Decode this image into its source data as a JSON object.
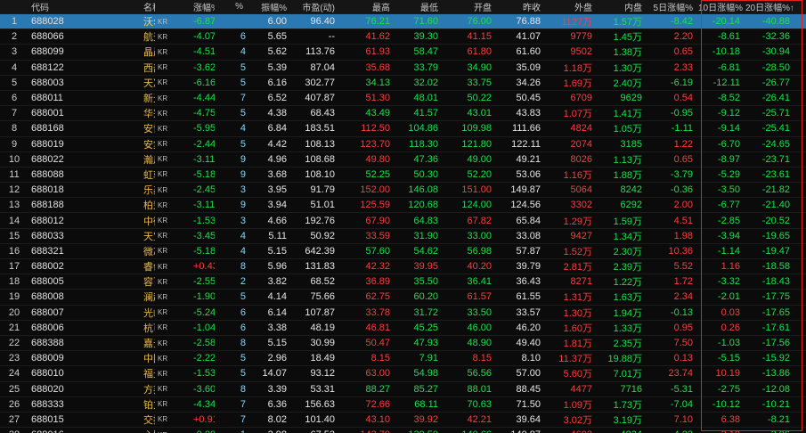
{
  "header": {
    "code": "代码",
    "name": "名称",
    "pct": "涨幅%",
    "pct_small": "%",
    "amp": "振幅%",
    "pe": "市盈(动)",
    "high": "最高",
    "low": "最低",
    "open": "开盘",
    "prev": "昨收",
    "outer": "外盘",
    "inner": "内盘",
    "d5": "5日涨幅%",
    "d10": "10日涨幅%",
    "d20": "20日涨幅%↑"
  },
  "colors": {
    "up": "#ff3c3c",
    "down": "#19e34a",
    "selected": "#2a79b3",
    "highlight_box": "#e0241b"
  },
  "rows": [
    {
      "idx": "1",
      "code": "688028",
      "name": "沃尔德",
      "tag": "KR",
      "pct": "-6.87%",
      "frag": "",
      "amp": "6.00",
      "pe": "96.40",
      "high": "76.21",
      "low": "71.60",
      "open": "76.00",
      "prev": "76.88",
      "outer": "1127万",
      "inner": "1.57万",
      "d5": "-8.42",
      "d10": "-20.14",
      "d20": "-40.88"
    },
    {
      "idx": "2",
      "code": "688066",
      "name": "航天宏图",
      "tag": "KR",
      "pct": "-4.07%",
      "frag": "6",
      "amp": "5.65",
      "pe": "--",
      "high": "41.62",
      "low": "39.30",
      "open": "41.15",
      "prev": "41.07",
      "outer": "9779",
      "inner": "1.45万",
      "d5": "2.20",
      "d10": "-8.61",
      "d20": "-32.36"
    },
    {
      "idx": "3",
      "code": "688099",
      "name": "晶晨股份",
      "tag": "KR",
      "pct": "-4.51%",
      "frag": "4",
      "amp": "5.62",
      "pe": "113.76",
      "high": "61.93",
      "low": "58.47",
      "open": "61.80",
      "prev": "61.60",
      "outer": "9502",
      "inner": "1.38万",
      "d5": "0.65",
      "d10": "-10.18",
      "d20": "-30.94"
    },
    {
      "idx": "4",
      "code": "688122",
      "name": "西部超导",
      "tag": "KR",
      "pct": "-3.62%",
      "frag": "5",
      "amp": "5.39",
      "pe": "87.04",
      "high": "35.68",
      "low": "33.79",
      "open": "34.90",
      "prev": "35.09",
      "outer": "1.18万",
      "inner": "1.30万",
      "d5": "2.33",
      "d10": "-6.81",
      "d20": "-28.50"
    },
    {
      "idx": "5",
      "code": "688003",
      "name": "天准科技",
      "tag": "KR",
      "pct": "-6.16%",
      "frag": "5",
      "amp": "6.16",
      "pe": "302.77",
      "high": "34.13",
      "low": "32.02",
      "open": "33.75",
      "prev": "34.26",
      "outer": "1.69万",
      "inner": "2.40万",
      "d5": "-6.19",
      "d10": "-12.11",
      "d20": "-26.77"
    },
    {
      "idx": "6",
      "code": "688011",
      "name": "新光光电",
      "tag": "KR",
      "pct": "-4.44%",
      "frag": "7",
      "amp": "6.52",
      "pe": "407.87",
      "high": "51.30",
      "low": "48.01",
      "open": "50.22",
      "prev": "50.45",
      "outer": "6709",
      "inner": "9629",
      "d5": "0.54",
      "d10": "-8.52",
      "d20": "-26.41"
    },
    {
      "idx": "7",
      "code": "688001",
      "name": "华兴源创",
      "tag": "KR",
      "pct": "-4.75%",
      "frag": "5",
      "amp": "4.38",
      "pe": "68.43",
      "high": "43.49",
      "low": "41.57",
      "open": "43.01",
      "prev": "43.83",
      "outer": "1.07万",
      "inner": "1.41万",
      "d5": "-0.95",
      "d10": "-9.12",
      "d20": "-25.71"
    },
    {
      "idx": "8",
      "code": "688168",
      "name": "安博通",
      "tag": "KR",
      "pct": "-5.95%",
      "frag": "4",
      "amp": "6.84",
      "pe": "183.51",
      "high": "112.50",
      "low": "104.86",
      "open": "109.98",
      "prev": "111.66",
      "outer": "4824",
      "inner": "1.05万",
      "d5": "-1.11",
      "d10": "-9.14",
      "d20": "-25.41"
    },
    {
      "idx": "9",
      "code": "688019",
      "name": "安集科技",
      "tag": "KR",
      "pct": "-2.44%",
      "frag": "5",
      "amp": "4.42",
      "pe": "108.13",
      "high": "123.70",
      "low": "118.30",
      "open": "121.80",
      "prev": "122.11",
      "outer": "2074",
      "inner": "3185",
      "d5": "1.22",
      "d10": "-6.70",
      "d20": "-24.65"
    },
    {
      "idx": "10",
      "code": "688022",
      "name": "瀚川智能",
      "tag": "KR",
      "pct": "-3.11%",
      "frag": "9",
      "amp": "4.96",
      "pe": "108.68",
      "high": "49.80",
      "low": "47.36",
      "open": "49.00",
      "prev": "49.21",
      "outer": "8026",
      "inner": "1.13万",
      "d5": "0.65",
      "d10": "-8.97",
      "d20": "-23.71"
    },
    {
      "idx": "11",
      "code": "688088",
      "name": "虹软科技",
      "tag": "KR",
      "pct": "-5.18%",
      "frag": "9",
      "amp": "3.68",
      "pe": "108.10",
      "high": "52.25",
      "low": "50.30",
      "open": "52.20",
      "prev": "53.06",
      "outer": "1.16万",
      "inner": "1.88万",
      "d5": "-3.79",
      "d10": "-5.29",
      "d20": "-23.61"
    },
    {
      "idx": "12",
      "code": "688018",
      "name": "乐鑫科技",
      "tag": "KR",
      "pct": "-2.45%",
      "frag": "3",
      "amp": "3.95",
      "pe": "91.79",
      "high": "152.00",
      "low": "146.08",
      "open": "151.00",
      "prev": "149.87",
      "outer": "5064",
      "inner": "8242",
      "d5": "-0.36",
      "d10": "-3.50",
      "d20": "-21.82"
    },
    {
      "idx": "13",
      "code": "688188",
      "name": "柏楚电子",
      "tag": "KR",
      "pct": "-3.11%",
      "frag": "9",
      "amp": "3.94",
      "pe": "51.01",
      "high": "125.59",
      "low": "120.68",
      "open": "124.00",
      "prev": "124.56",
      "outer": "3302",
      "inner": "6292",
      "d5": "2.00",
      "d10": "-6.77",
      "d20": "-21.40"
    },
    {
      "idx": "14",
      "code": "688012",
      "name": "中微公司",
      "tag": "KR",
      "pct": "-1.53%",
      "frag": "3",
      "amp": "4.66",
      "pe": "192.76",
      "high": "67.90",
      "low": "64.83",
      "open": "67.82",
      "prev": "65.84",
      "outer": "1.29万",
      "inner": "1.59万",
      "d5": "4.51",
      "d10": "-2.85",
      "d20": "-20.52"
    },
    {
      "idx": "15",
      "code": "688033",
      "name": "天宜上佳",
      "tag": "KR",
      "pct": "-3.45%",
      "frag": "4",
      "amp": "5.11",
      "pe": "50.92",
      "high": "33.59",
      "low": "31.90",
      "open": "33.00",
      "prev": "33.08",
      "outer": "9427",
      "inner": "1.34万",
      "d5": "1.98",
      "d10": "-3.94",
      "d20": "-19.65"
    },
    {
      "idx": "16",
      "code": "688321",
      "name": "微芯生物",
      "tag": "KR",
      "pct": "-5.18%",
      "frag": "4",
      "amp": "5.15",
      "pe": "642.39",
      "high": "57.60",
      "low": "54.62",
      "open": "56.98",
      "prev": "57.87",
      "outer": "1.52万",
      "inner": "2.30万",
      "d5": "10.36",
      "d10": "-1.14",
      "d20": "-19.47"
    },
    {
      "idx": "17",
      "code": "688002",
      "name": "睿创微纳",
      "tag": "KR",
      "pct": "+0.43%",
      "frag": "8",
      "amp": "5.96",
      "pe": "131.83",
      "high": "42.32",
      "low": "39.95",
      "open": "40.20",
      "prev": "39.79",
      "outer": "2.81万",
      "inner": "2.39万",
      "d5": "5.52",
      "d10": "1.16",
      "d20": "-18.58"
    },
    {
      "idx": "18",
      "code": "688005",
      "name": "容百科技",
      "tag": "KR",
      "pct": "-2.55%",
      "frag": "2",
      "amp": "3.82",
      "pe": "68.52",
      "high": "36.89",
      "low": "35.50",
      "open": "36.41",
      "prev": "36.43",
      "outer": "8271",
      "inner": "1.22万",
      "d5": "1.72",
      "d10": "-3.32",
      "d20": "-18.43"
    },
    {
      "idx": "19",
      "code": "688008",
      "name": "澜起科技",
      "tag": "KR",
      "pct": "-1.90%",
      "frag": "5",
      "amp": "4.14",
      "pe": "75.66",
      "high": "62.75",
      "low": "60.20",
      "open": "61.57",
      "prev": "61.55",
      "outer": "1.31万",
      "inner": "1.63万",
      "d5": "2.34",
      "d10": "-2.01",
      "d20": "-17.75"
    },
    {
      "idx": "20",
      "code": "688007",
      "name": "光峰科技",
      "tag": "KR",
      "pct": "-5.24%",
      "frag": "6",
      "amp": "6.14",
      "pe": "107.87",
      "high": "33.78",
      "low": "31.72",
      "open": "33.50",
      "prev": "33.57",
      "outer": "1.30万",
      "inner": "1.94万",
      "d5": "-0.13",
      "d10": "0.03",
      "d20": "-17.65"
    },
    {
      "idx": "21",
      "code": "688006",
      "name": "杭可科技",
      "tag": "KR",
      "pct": "-1.04%",
      "frag": "6",
      "amp": "3.38",
      "pe": "48.19",
      "high": "46.81",
      "low": "45.25",
      "open": "46.00",
      "prev": "46.20",
      "outer": "1.60万",
      "inner": "1.33万",
      "d5": "0.95",
      "d10": "0.26",
      "d20": "-17.61"
    },
    {
      "idx": "22",
      "code": "688388",
      "name": "嘉元科技",
      "tag": "KR",
      "pct": "-2.58%",
      "frag": "8",
      "amp": "5.15",
      "pe": "30.99",
      "high": "50.47",
      "low": "47.93",
      "open": "48.90",
      "prev": "49.40",
      "outer": "1.81万",
      "inner": "2.35万",
      "d5": "7.50",
      "d10": "-1.03",
      "d20": "-17.56"
    },
    {
      "idx": "23",
      "code": "688009",
      "name": "中国通号",
      "tag": "KR",
      "pct": "-2.22%",
      "frag": "5",
      "amp": "2.96",
      "pe": "18.49",
      "high": "8.15",
      "low": "7.91",
      "open": "8.15",
      "prev": "8.10",
      "outer": "11.37万",
      "inner": "19.88万",
      "d5": "0.13",
      "d10": "-5.15",
      "d20": "-15.92"
    },
    {
      "idx": "24",
      "code": "688010",
      "name": "福光股份",
      "tag": "KR",
      "pct": "-1.53%",
      "frag": "5",
      "amp": "14.07",
      "pe": "93.12",
      "high": "63.00",
      "low": "54.98",
      "open": "56.56",
      "prev": "57.00",
      "outer": "5.60万",
      "inner": "7.01万",
      "d5": "23.74",
      "d10": "10.19",
      "d20": "-13.86"
    },
    {
      "idx": "25",
      "code": "688020",
      "name": "方邦股份",
      "tag": "KR",
      "pct": "-3.60%",
      "frag": "8",
      "amp": "3.39",
      "pe": "53.31",
      "high": "88.27",
      "low": "85.27",
      "open": "88.01",
      "prev": "88.45",
      "outer": "4477",
      "inner": "7716",
      "d5": "-5.31",
      "d10": "-2.75",
      "d20": "-12.08"
    },
    {
      "idx": "26",
      "code": "688333",
      "name": "铂力特",
      "tag": "KR",
      "pct": "-4.34%",
      "frag": "7",
      "amp": "6.36",
      "pe": "156.63",
      "high": "72.66",
      "low": "68.11",
      "open": "70.63",
      "prev": "71.50",
      "outer": "1.09万",
      "inner": "1.73万",
      "d5": "-7.04",
      "d10": "-10.12",
      "d20": "-10.21"
    },
    {
      "idx": "27",
      "code": "688015",
      "name": "交控科技",
      "tag": "KR",
      "pct": "+0.91%",
      "frag": "7",
      "amp": "8.02",
      "pe": "101.40",
      "high": "43.10",
      "low": "39.92",
      "open": "42.21",
      "prev": "39.64",
      "outer": "3.02万",
      "inner": "3.19万",
      "d5": "7.10",
      "d10": "6.38",
      "d20": "-8.21"
    },
    {
      "idx": "28",
      "code": "688016",
      "name": "心脉医疗",
      "tag": "KR",
      "pct": "-0.08%",
      "frag": "1",
      "amp": "2.98",
      "pe": "67.52",
      "high": "143.70",
      "low": "139.50",
      "open": "140.66",
      "prev": "140.87",
      "outer": "4692",
      "inner": "4824",
      "d5": "-4.02",
      "d10": "2.18",
      "d20": "-2.96"
    }
  ]
}
